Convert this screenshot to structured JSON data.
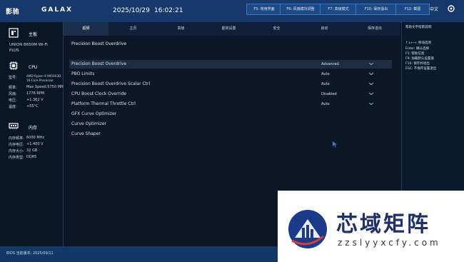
{
  "header": {
    "brand_cn": "影驰",
    "brand_en": "GALAX",
    "date": "2025/10/29",
    "time": "16:02:21",
    "fkeys": [
      "F5: 常用界面",
      "F6: 风扇模块调整",
      "F7: 高级模式",
      "F10: 保存退出",
      "F12: 截图"
    ],
    "language": "中文",
    "gear_icon": "settings-icon"
  },
  "sidebar": {
    "mainboard": {
      "title": "主板",
      "model": "UNION B650M Wi-Fi",
      "model_sub": "PLUS"
    },
    "cpu": {
      "title": "CPU",
      "rows": [
        {
          "k": "型号:",
          "v": "AMD Ryzen 9 9950X3D"
        },
        {
          "k": "",
          "v": "16-Core Processor"
        },
        {
          "k": "频率:",
          "v": "Max Speed:5750 MHz"
        },
        {
          "k": "风扇:",
          "v": "1776 RPM"
        },
        {
          "k": "电压:",
          "v": "+1.362 V"
        },
        {
          "k": "温度:",
          "v": "+55°C"
        }
      ]
    },
    "memory": {
      "title": "内存",
      "rows": [
        {
          "k": "内存频率:",
          "v": "6000 MHz"
        },
        {
          "k": "内存电压:",
          "v": "+1.400 V"
        },
        {
          "k": "内存大小:",
          "v": "32 GB"
        },
        {
          "k": "内存类型:",
          "v": "DDR5"
        }
      ]
    }
  },
  "tabs": [
    "超频",
    "主页",
    "高级",
    "能效设置",
    "安全",
    "启动",
    "保存退出"
  ],
  "main": {
    "section_title": "Precision Boost Overdrive",
    "rows": [
      {
        "label": "Precision Boost Overdrive",
        "value": "Advanced",
        "has_dropdown": true
      },
      {
        "label": "PBO Limits",
        "value": "Auto",
        "has_dropdown": true
      },
      {
        "label": "Precision Boost Overdrive Scalar Ctrl",
        "value": "Auto",
        "has_dropdown": true
      },
      {
        "label": "CPU Boost Clock Override",
        "value": "Disabled",
        "has_dropdown": true
      },
      {
        "label": "Platform Thermal Throttle Ctrl",
        "value": "Auto",
        "has_dropdown": true
      },
      {
        "label": "GFX Curve Optimizer",
        "value": "",
        "has_dropdown": false
      },
      {
        "label": "Curve Optimizer",
        "value": "",
        "has_dropdown": false
      },
      {
        "label": "Curve Shaper",
        "value": "",
        "has_dropdown": false
      }
    ]
  },
  "help": {
    "title": "帮助文字指南说明:",
    "lines": [
      "↑↓←→: 移动选项",
      "Enter: 确认选择",
      "F1:  帮助信息",
      "F9:  加载默认设置值",
      "F10: 保存并退出",
      "ESC: 不保存设置退出"
    ]
  },
  "footer": {
    "bios_version": "BIOS 当前版本: 2025/09/11"
  },
  "watermark": {
    "title": "芯域矩阵",
    "url": "zzslyyxcfy.com"
  }
}
